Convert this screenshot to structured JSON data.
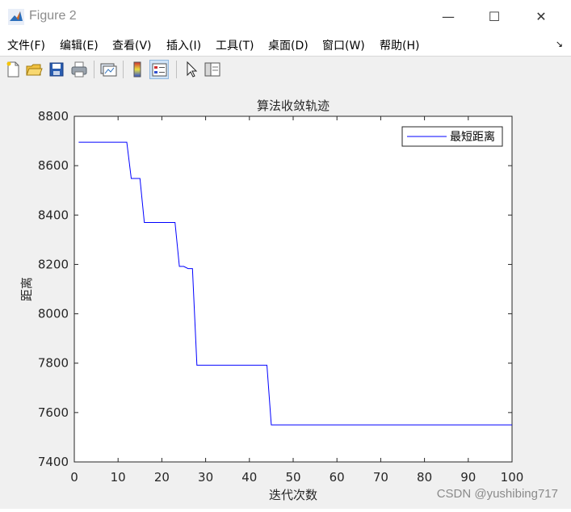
{
  "window": {
    "title": "Figure 2",
    "minimize_label": "—",
    "maximize_label": "☐",
    "close_label": "✕"
  },
  "menu": {
    "items": [
      "文件(F)",
      "编辑(E)",
      "查看(V)",
      "插入(I)",
      "工具(T)",
      "桌面(D)",
      "窗口(W)",
      "帮助(H)"
    ],
    "dock_label": "↘"
  },
  "toolbar": {
    "buttons": [
      "new-figure-icon",
      "open-file-icon",
      "save-icon",
      "print-icon",
      "link-plot-icon",
      "colorbar-icon",
      "legend-icon",
      "pointer-icon",
      "property-editor-icon"
    ]
  },
  "chart_data": {
    "type": "line",
    "title": "算法收敛轨迹",
    "xlabel": "迭代次数",
    "ylabel": "距离",
    "xlim": [
      0,
      100
    ],
    "ylim": [
      7400,
      8800
    ],
    "xticks": [
      "0",
      "10",
      "20",
      "30",
      "40",
      "50",
      "60",
      "70",
      "80",
      "90",
      "100"
    ],
    "yticks": [
      "7400",
      "7600",
      "7800",
      "8000",
      "8200",
      "8400",
      "8600",
      "8800"
    ],
    "legend_position": "top-right",
    "series": [
      {
        "name": "最短距离",
        "color": "#0000ff",
        "x": [
          1,
          12,
          13,
          15,
          16,
          23,
          24,
          25,
          26,
          27,
          28,
          44,
          45,
          100
        ],
        "y": [
          8695,
          8695,
          8548,
          8548,
          8370,
          8370,
          8192,
          8192,
          8183,
          8183,
          7792,
          7792,
          7550,
          7550
        ]
      }
    ]
  },
  "watermark": "CSDN @yushibing717"
}
